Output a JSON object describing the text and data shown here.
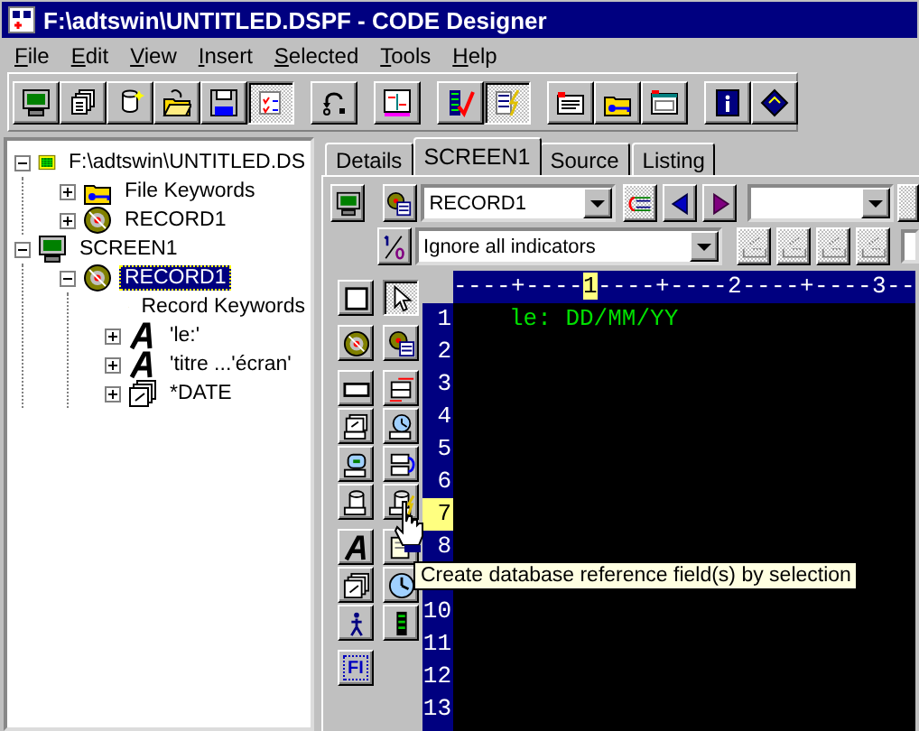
{
  "window": {
    "title": "F:\\adtswin\\UNTITLED.DSPF - CODE Designer"
  },
  "menu": [
    "File",
    "Edit",
    "View",
    "Insert",
    "Selected",
    "Tools",
    "Help"
  ],
  "toolbar": [
    [
      {
        "kind": "monitor",
        "pressed": false
      },
      {
        "kind": "pages",
        "pressed": false
      },
      {
        "kind": "cylinder",
        "pressed": false
      },
      {
        "kind": "folder",
        "pressed": false
      },
      {
        "kind": "disk",
        "pressed": false
      },
      {
        "kind": "checklist",
        "pressed": true
      }
    ],
    [
      {
        "kind": "undo",
        "pressed": false
      }
    ],
    [
      {
        "kind": "layout",
        "pressed": false
      }
    ],
    [
      {
        "kind": "check",
        "pressed": false
      },
      {
        "kind": "lightning",
        "pressed": true
      }
    ],
    [
      {
        "kind": "card",
        "pressed": false
      },
      {
        "kind": "key",
        "pressed": false
      },
      {
        "kind": "window",
        "pressed": false
      }
    ],
    [
      {
        "kind": "book",
        "pressed": false
      },
      {
        "kind": "diamond",
        "pressed": false
      }
    ]
  ],
  "tree": [
    {
      "label": "F:\\adtswin\\UNTITLED.DS",
      "kind": "file",
      "expanded": true,
      "selected": false,
      "children": [
        {
          "label": "File Keywords",
          "kind": "keywords",
          "expanded": false,
          "selected": false
        },
        {
          "label": "RECORD1",
          "kind": "record",
          "expanded": false,
          "selected": false
        }
      ]
    },
    {
      "label": "SCREEN1",
      "kind": "screen",
      "expanded": true,
      "selected": false,
      "children": [
        {
          "label": "RECORD1",
          "kind": "record",
          "expanded": true,
          "selected": true,
          "children": [
            {
              "label": "Record Keywords",
              "kind": "keywords",
              "selected": false
            },
            {
              "label": "'le:'",
              "kind": "text",
              "expanded": false,
              "selected": false
            },
            {
              "label": "'titre ...'écran'",
              "kind": "text",
              "expanded": false,
              "selected": false
            },
            {
              "label": "*DATE",
              "kind": "date",
              "expanded": false,
              "selected": false
            }
          ]
        }
      ]
    }
  ],
  "tabs": [
    {
      "label": "Details",
      "selected": false
    },
    {
      "label": "SCREEN1",
      "selected": true
    },
    {
      "label": "Source",
      "selected": false
    },
    {
      "label": "Listing",
      "selected": false
    }
  ],
  "format_bar": {
    "record_select": {
      "value": "RECORD1"
    },
    "buttons": [
      {
        "kind": "lines",
        "disabled": true
      },
      {
        "kind": "prev",
        "disabled": false
      },
      {
        "kind": "next",
        "disabled": false
      }
    ]
  },
  "indicator_bar": {
    "indicator_select": {
      "value": "Ignore all indicators"
    },
    "buttons": [
      {
        "kind": "tray",
        "disabled": true
      },
      {
        "kind": "tray",
        "disabled": true
      },
      {
        "kind": "tray",
        "disabled": true
      },
      {
        "kind": "tray",
        "disabled": true
      }
    ]
  },
  "ruler": {
    "before": "----+----",
    "mark": "1",
    "after": "----+----2----+----3--"
  },
  "lines": [
    {
      "number": "1",
      "text": "le: DD/MM/YY",
      "selected": false
    },
    {
      "number": "2",
      "selected": false
    },
    {
      "number": "3",
      "selected": false
    },
    {
      "number": "4",
      "selected": false
    },
    {
      "number": "5",
      "selected": false
    },
    {
      "number": "6",
      "selected": false
    },
    {
      "number": "7",
      "selected": true
    },
    {
      "number": "8",
      "selected": false
    },
    {
      "selected": false
    },
    {
      "number": "10",
      "selected": false
    },
    {
      "number": "11",
      "selected": false
    },
    {
      "number": "12",
      "selected": false
    },
    {
      "number": "13",
      "selected": false
    }
  ],
  "palette": [
    [
      {
        "kind": "checkbox",
        "pressed": false
      },
      {
        "kind": "pointer",
        "pressed": true
      }
    ],
    [
      {
        "kind": "disc",
        "pressed": false
      },
      {
        "kind": "disclist",
        "pressed": false
      }
    ],
    [
      {
        "kind": "field",
        "pressed": false
      },
      {
        "kind": "fieldarrows",
        "pressed": false
      },
      {
        "kind": "calfield",
        "pressed": false
      },
      {
        "kind": "clockfield",
        "pressed": false
      },
      {
        "kind": "gaugefield",
        "pressed": false
      },
      {
        "kind": "fieldcycle",
        "pressed": false
      },
      {
        "kind": "cylfield",
        "pressed": false
      },
      {
        "kind": "cyllightning",
        "pressed": false
      }
    ],
    [
      {
        "kind": "letter",
        "pressed": false
      },
      {
        "kind": "note",
        "pressed": false
      },
      {
        "kind": "calendar",
        "pressed": false
      },
      {
        "kind": "clock",
        "pressed": false
      },
      {
        "kind": "figure",
        "pressed": false
      },
      {
        "kind": "bars",
        "pressed": false
      }
    ],
    [
      {
        "kind": "label",
        "label": "FI",
        "pressed": false
      }
    ]
  ],
  "tooltip": "Create database reference field(s) by selection"
}
